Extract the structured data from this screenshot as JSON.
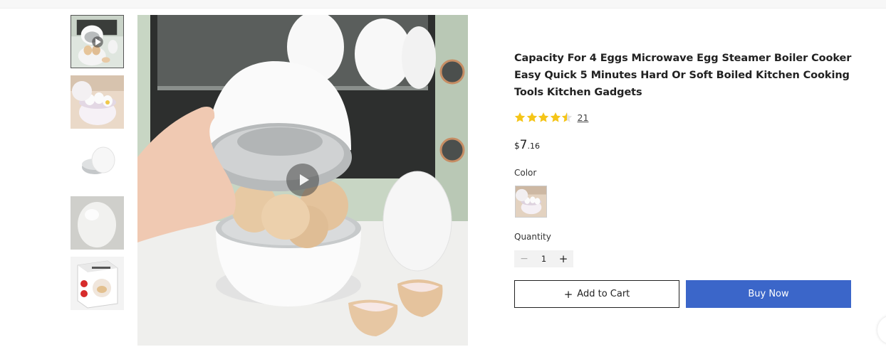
{
  "product": {
    "title": "Capacity For 4 Eggs Microwave Egg Steamer Boiler Cooker Easy Quick 5 Minutes Hard Or Soft Boiled Kitchen Cooking Tools Kitchen Gadgets",
    "rating": 4.5,
    "review_count": "21",
    "price": {
      "currency": "$",
      "integer": "7",
      "decimal": ".16"
    }
  },
  "gallery": {
    "thumbnails": [
      "video-thumbnail",
      "egg-steamer-open",
      "egg-steamer-closed",
      "egg-steamer-closeup",
      "product-box"
    ],
    "active_index": 0
  },
  "options": {
    "color_label": "Color",
    "quantity_label": "Quantity",
    "quantity_value": "1",
    "minus_symbol": "−",
    "plus_symbol": "+"
  },
  "actions": {
    "add_to_cart_icon": "+",
    "add_to_cart_label": "Add to Cart",
    "buy_now_label": "Buy Now"
  },
  "colors": {
    "star": "#f5c518",
    "buy_now": "#3b66c9"
  }
}
